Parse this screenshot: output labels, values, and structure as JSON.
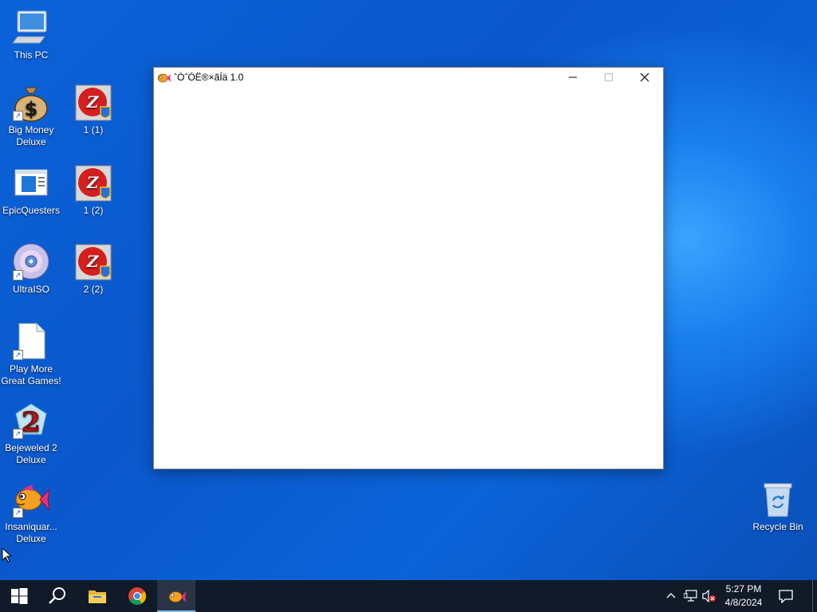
{
  "desktop": {
    "icons": [
      {
        "label": "This PC"
      },
      {
        "label": "Big Money Deluxe"
      },
      {
        "label": "1 (1)"
      },
      {
        "label": "EpicQuesters"
      },
      {
        "label": "1 (2)"
      },
      {
        "label": "UltraISO"
      },
      {
        "label": "2 (2)"
      },
      {
        "label": "Play More Great Games!"
      },
      {
        "label": "Bejeweled 2 Deluxe"
      },
      {
        "label": "Insaniquar... Deluxe"
      },
      {
        "label": "Recycle Bin"
      }
    ]
  },
  "window": {
    "title": "ˆÓˆÓË®×ãÍä 1.0",
    "icon": "fish-icon"
  },
  "taskbar": {
    "time": "5:27 PM",
    "date": "4/8/2024",
    "items": [
      "start-icon",
      "search-icon",
      "file-explorer-icon",
      "chrome-icon",
      "fish-app-icon"
    ]
  },
  "colors": {
    "taskbar_bg": "#101a28",
    "accent": "#76b9ed",
    "desktop_bg": "#0b62d8"
  }
}
